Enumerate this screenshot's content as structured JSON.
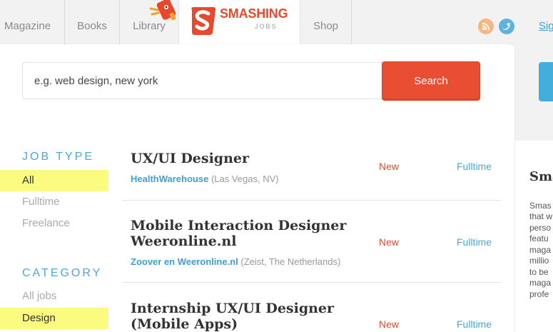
{
  "nav": {
    "items": [
      "Magazine",
      "Books",
      "Library",
      "Shop"
    ],
    "logo_word": "SMASHING",
    "logo_sub": "JOBS",
    "signin": "Sig"
  },
  "search": {
    "placeholder": "e.g. web design, new york",
    "button_label": "Search"
  },
  "sidebar": {
    "job_type": {
      "heading": "JOB TYPE",
      "items": [
        {
          "label": "All",
          "active": true
        },
        {
          "label": "Fulltime",
          "active": false
        },
        {
          "label": "Freelance",
          "active": false
        }
      ]
    },
    "category": {
      "heading": "CATEGORY",
      "items": [
        {
          "label": "All jobs",
          "active": false
        },
        {
          "label": "Design",
          "active": true
        }
      ]
    }
  },
  "jobs": [
    {
      "title": "UX/UI Designer",
      "company": "HealthWarehouse",
      "location": "(Las Vegas, NV)",
      "badge": "New",
      "type": "Fulltime"
    },
    {
      "title": "Mobile Interaction Designer Weeronline.nl",
      "company": "Zoover en Weeronline.nl",
      "location": "(Zeist, The Netherlands)",
      "badge": "New",
      "type": "Fulltime"
    },
    {
      "title": "Internship UX/UI Designer (Mobile Apps)",
      "company": "",
      "location": "",
      "badge": "New",
      "type": "Fulltime"
    }
  ],
  "right_panel": {
    "heading": "Sma",
    "lines": [
      "Smas",
      "that w",
      "perso",
      "featu",
      "maga",
      "millio",
      "to be",
      "maga",
      "profe"
    ]
  },
  "colors": {
    "accent_red": "#e94e32",
    "link_blue": "#3d9fd6",
    "highlight_yellow": "#fbfb7f"
  },
  "icons": [
    "rss-icon",
    "twitter-icon",
    "smashing-logo-icon",
    "mascot-icon"
  ]
}
